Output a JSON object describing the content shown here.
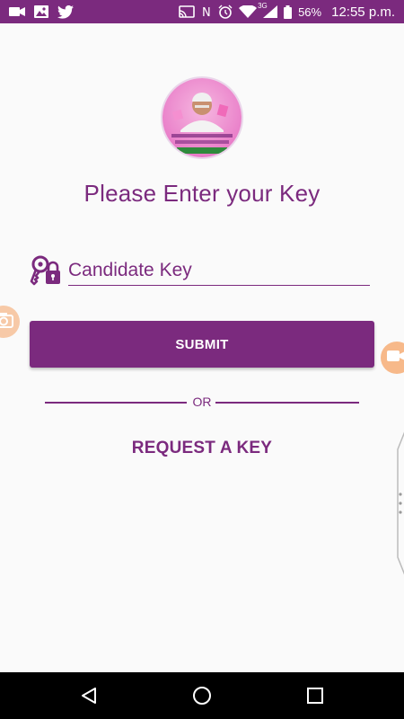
{
  "statusbar": {
    "battery": "56%",
    "time": "12:55 p.m.",
    "network": "3G",
    "icons": [
      "video-icon",
      "image-icon",
      "twitter-icon",
      "cast-icon",
      "nfc-icon",
      "alarm-icon",
      "wifi-icon",
      "signal-icon",
      "battery-icon"
    ]
  },
  "logo": {
    "icon": "logo-portrait-icon"
  },
  "title": "Please Enter your Key",
  "key_input": {
    "placeholder": "Candidate Key",
    "value": "",
    "icon": "key-lock-icon"
  },
  "submit_label": "SUBMIT",
  "or_label": "OR",
  "request_key_label": "REQUEST A KEY",
  "colors": {
    "primary": "#7b2a7e",
    "statusbar": "#7b2a7e",
    "background": "#fafafa",
    "float": "#f7b98a"
  },
  "navbar": {
    "icons": [
      "back-icon",
      "home-icon",
      "recents-icon"
    ]
  }
}
